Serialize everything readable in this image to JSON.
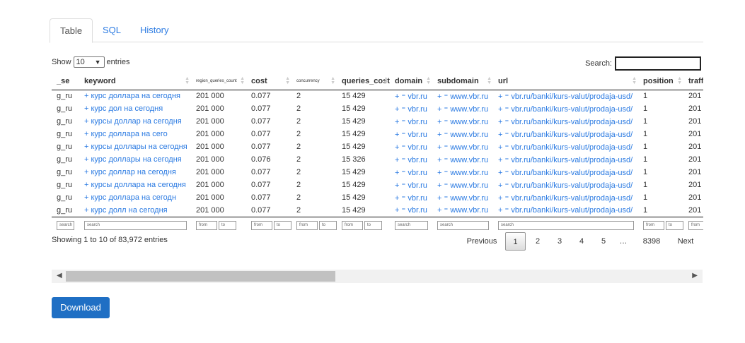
{
  "tabs": [
    {
      "label": "Table"
    },
    {
      "label": "SQL"
    },
    {
      "label": "History"
    }
  ],
  "length_control": {
    "prefix": "Show",
    "value": "10",
    "suffix": "entries"
  },
  "search": {
    "label": "Search:"
  },
  "columns": [
    "_se",
    "keyword",
    "region_queries_count",
    "cost",
    "concurrency",
    "queries_cost",
    "domain",
    "subdomain",
    "url",
    "position",
    "traffic"
  ],
  "rows": [
    [
      "g_ru",
      "+ курс доллара на сегодня",
      "201 000",
      "0.077",
      "2",
      "15 429",
      "+ ⁼ vbr.ru",
      "+ ⁼ www.vbr.ru",
      "+ ⁼ vbr.ru/banki/kurs-valut/prodaja-usd/",
      "1",
      "201"
    ],
    [
      "g_ru",
      "+ курс дол на сегодня",
      "201 000",
      "0.077",
      "2",
      "15 429",
      "+ ⁼ vbr.ru",
      "+ ⁼ www.vbr.ru",
      "+ ⁼ vbr.ru/banki/kurs-valut/prodaja-usd/",
      "1",
      "201"
    ],
    [
      "g_ru",
      "+ курсы доллар на сегодня",
      "201 000",
      "0.077",
      "2",
      "15 429",
      "+ ⁼ vbr.ru",
      "+ ⁼ www.vbr.ru",
      "+ ⁼ vbr.ru/banki/kurs-valut/prodaja-usd/",
      "1",
      "201"
    ],
    [
      "g_ru",
      "+ курс доллара на сего",
      "201 000",
      "0.077",
      "2",
      "15 429",
      "+ ⁼ vbr.ru",
      "+ ⁼ www.vbr.ru",
      "+ ⁼ vbr.ru/banki/kurs-valut/prodaja-usd/",
      "1",
      "201"
    ],
    [
      "g_ru",
      "+ курсы доллары на сегодня",
      "201 000",
      "0.077",
      "2",
      "15 429",
      "+ ⁼ vbr.ru",
      "+ ⁼ www.vbr.ru",
      "+ ⁼ vbr.ru/banki/kurs-valut/prodaja-usd/",
      "1",
      "201"
    ],
    [
      "g_ru",
      "+ курс доллары на сегодня",
      "201 000",
      "0.076",
      "2",
      "15 326",
      "+ ⁼ vbr.ru",
      "+ ⁼ www.vbr.ru",
      "+ ⁼ vbr.ru/banki/kurs-valut/prodaja-usd/",
      "1",
      "201"
    ],
    [
      "g_ru",
      "+ курс доллар на сегодня",
      "201 000",
      "0.077",
      "2",
      "15 429",
      "+ ⁼ vbr.ru",
      "+ ⁼ www.vbr.ru",
      "+ ⁼ vbr.ru/banki/kurs-valut/prodaja-usd/",
      "1",
      "201"
    ],
    [
      "g_ru",
      "+ курсы доллара на сегодня",
      "201 000",
      "0.077",
      "2",
      "15 429",
      "+ ⁼ vbr.ru",
      "+ ⁼ www.vbr.ru",
      "+ ⁼ vbr.ru/banki/kurs-valut/prodaja-usd/",
      "1",
      "201"
    ],
    [
      "g_ru",
      "+ курс доллара на сегодн",
      "201 000",
      "0.077",
      "2",
      "15 429",
      "+ ⁼ vbr.ru",
      "+ ⁼ www.vbr.ru",
      "+ ⁼ vbr.ru/banki/kurs-valut/prodaja-usd/",
      "1",
      "201"
    ],
    [
      "g_ru",
      "+ курс долл на сегодня",
      "201 000",
      "0.077",
      "2",
      "15 429",
      "+ ⁼ vbr.ru",
      "+ ⁼ www.vbr.ru",
      "+ ⁼ vbr.ru/banki/kurs-valut/prodaja-usd/",
      "1",
      "201"
    ]
  ],
  "filters": {
    "search": "search",
    "from": "from",
    "to": "to"
  },
  "info": "Showing 1 to 10 of 83,972 entries",
  "pagination": {
    "previous": "Previous",
    "pages": [
      "1",
      "2",
      "3",
      "4",
      "5",
      "…",
      "8398"
    ],
    "current": "1",
    "next": "Next"
  },
  "download_label": "Download",
  "colors": {
    "link": "#2a7ae2",
    "button": "#1f6fc4"
  },
  "icons": {
    "scroll_left": "triangle-left-icon",
    "scroll_right": "triangle-right-icon",
    "sort": "sort-icon"
  }
}
